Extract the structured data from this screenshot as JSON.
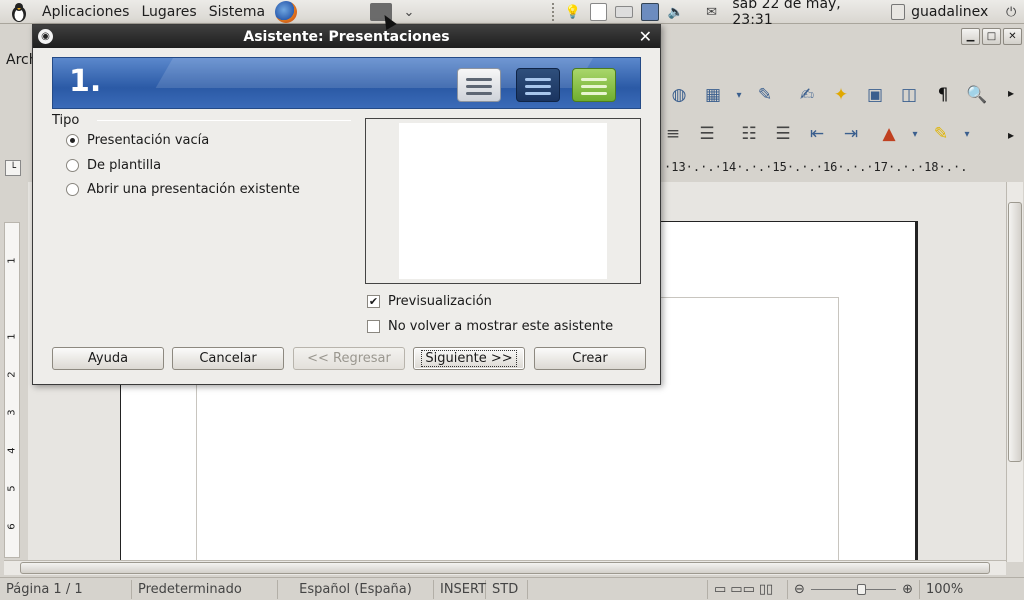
{
  "panel": {
    "menus": [
      "Aplicaciones",
      "Lugares",
      "Sistema"
    ],
    "clock": "sáb 22 de may, 23:31",
    "user": "guadalinex"
  },
  "writer": {
    "menubar_partial": "Arch",
    "ruler_text": "·13·.·.·14·.·.·15·.·.·16·.·.·17·.·.·18·.·.",
    "vruler_labels": [
      "1",
      "1",
      "2",
      "3",
      "4",
      "5",
      "6"
    ],
    "status": {
      "page": "Página  1 / 1",
      "style": "Predeterminado",
      "language": "Español (España)",
      "insert": "INSERT",
      "selection": "STD",
      "zoom": "100%",
      "zoom_fraction": 0.5
    }
  },
  "dialog": {
    "title": "Asistente: Presentaciones",
    "step": "1.",
    "group_label": "Tipo",
    "options": [
      {
        "label": "Presentación vacía",
        "selected": true
      },
      {
        "label": "De plantilla",
        "selected": false
      },
      {
        "label": "Abrir una presentación existente",
        "selected": false
      }
    ],
    "checks": [
      {
        "label": "Previsualización",
        "checked": true
      },
      {
        "label": "No volver a mostrar este asistente",
        "checked": false
      }
    ],
    "buttons": {
      "help": "Ayuda",
      "cancel": "Cancelar",
      "back": "<< Regresar",
      "next": "Siguiente >>",
      "create": "Crear"
    }
  }
}
